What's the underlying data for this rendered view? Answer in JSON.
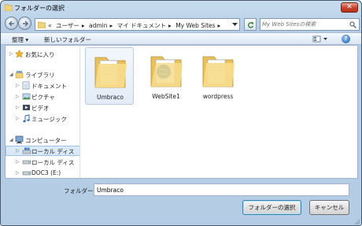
{
  "window": {
    "title": "フォルダーの選択"
  },
  "address": {
    "prefix": "«",
    "crumbs": [
      "ユーザー",
      "admin",
      "マイ ドキュメント",
      "My Web Sites"
    ],
    "search_placeholder": "My Web Sitesの検索"
  },
  "toolbar": {
    "organize_label": "整理 ▾",
    "new_folder_label": "新しいフォルダー"
  },
  "nav": {
    "favorites": "お気に入り",
    "libraries": "ライブラリ",
    "documents": "ドキュメント",
    "pictures": "ピクチャ",
    "videos": "ビデオ",
    "music": "ミュージック",
    "computer": "コンピューター",
    "local_disk_1": "ローカル ディス",
    "local_disk_2": "ローカル ディス",
    "doc3": "DOC3 (E:)"
  },
  "folders": [
    {
      "name": "Umbraco"
    },
    {
      "name": "WebSite1"
    },
    {
      "name": "wordpress"
    }
  ],
  "bottom": {
    "folder_label": "フォルダー:",
    "folder_value": "Umbraco",
    "select_label": "フォルダーの選択",
    "cancel_label": "キャンセル"
  },
  "colors": {
    "folder_yellow": "#f2d27a",
    "selection_bg": "#dbeaf8",
    "close_red": "#c7412a"
  }
}
